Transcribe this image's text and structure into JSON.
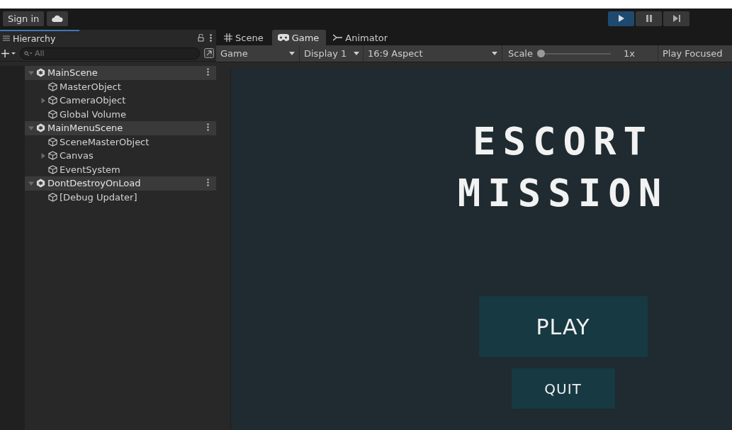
{
  "toolbar": {
    "sign_in": "Sign in",
    "play_controls": [
      {
        "kind": "play",
        "active": true
      },
      {
        "kind": "pause",
        "active": false
      },
      {
        "kind": "step",
        "active": false
      }
    ]
  },
  "hierarchy": {
    "tab": "Hierarchy",
    "search": {
      "placeholder": "All"
    },
    "items": [
      {
        "label": "MainScene",
        "kind": "scene",
        "expanded": true,
        "children": [
          {
            "label": "MasterObject",
            "kind": "object"
          },
          {
            "label": "CameraObject",
            "kind": "object",
            "expanded": false
          },
          {
            "label": "Global Volume",
            "kind": "object"
          }
        ]
      },
      {
        "label": "MainMenuScene",
        "kind": "scene",
        "expanded": true,
        "children": [
          {
            "label": "SceneMasterObject",
            "kind": "object"
          },
          {
            "label": "Canvas",
            "kind": "object",
            "expanded": false
          },
          {
            "label": "EventSystem",
            "kind": "object"
          }
        ]
      },
      {
        "label": "DontDestroyOnLoad",
        "kind": "scene",
        "expanded": true,
        "children": [
          {
            "label": "[Debug Updater]",
            "kind": "object"
          }
        ]
      }
    ]
  },
  "view_tabs": [
    {
      "label": "Scene",
      "kind": "scene",
      "selected": false
    },
    {
      "label": "Game",
      "kind": "game",
      "selected": true
    },
    {
      "label": "Animator",
      "kind": "animator",
      "selected": false
    }
  ],
  "game_toolbar": {
    "view_mode": "Game",
    "display": "Display 1",
    "aspect": "16:9 Aspect",
    "scale_label": "Scale",
    "scale": {
      "level": 0.0
    },
    "scale_value": "1x",
    "play_mode": "Play Focused"
  },
  "game": {
    "title_lines": [
      "ESCORT",
      "MISSION"
    ],
    "buttons": [
      {
        "label": "PLAY",
        "kind": "large"
      },
      {
        "label": "QUIT",
        "kind": "small"
      }
    ]
  }
}
